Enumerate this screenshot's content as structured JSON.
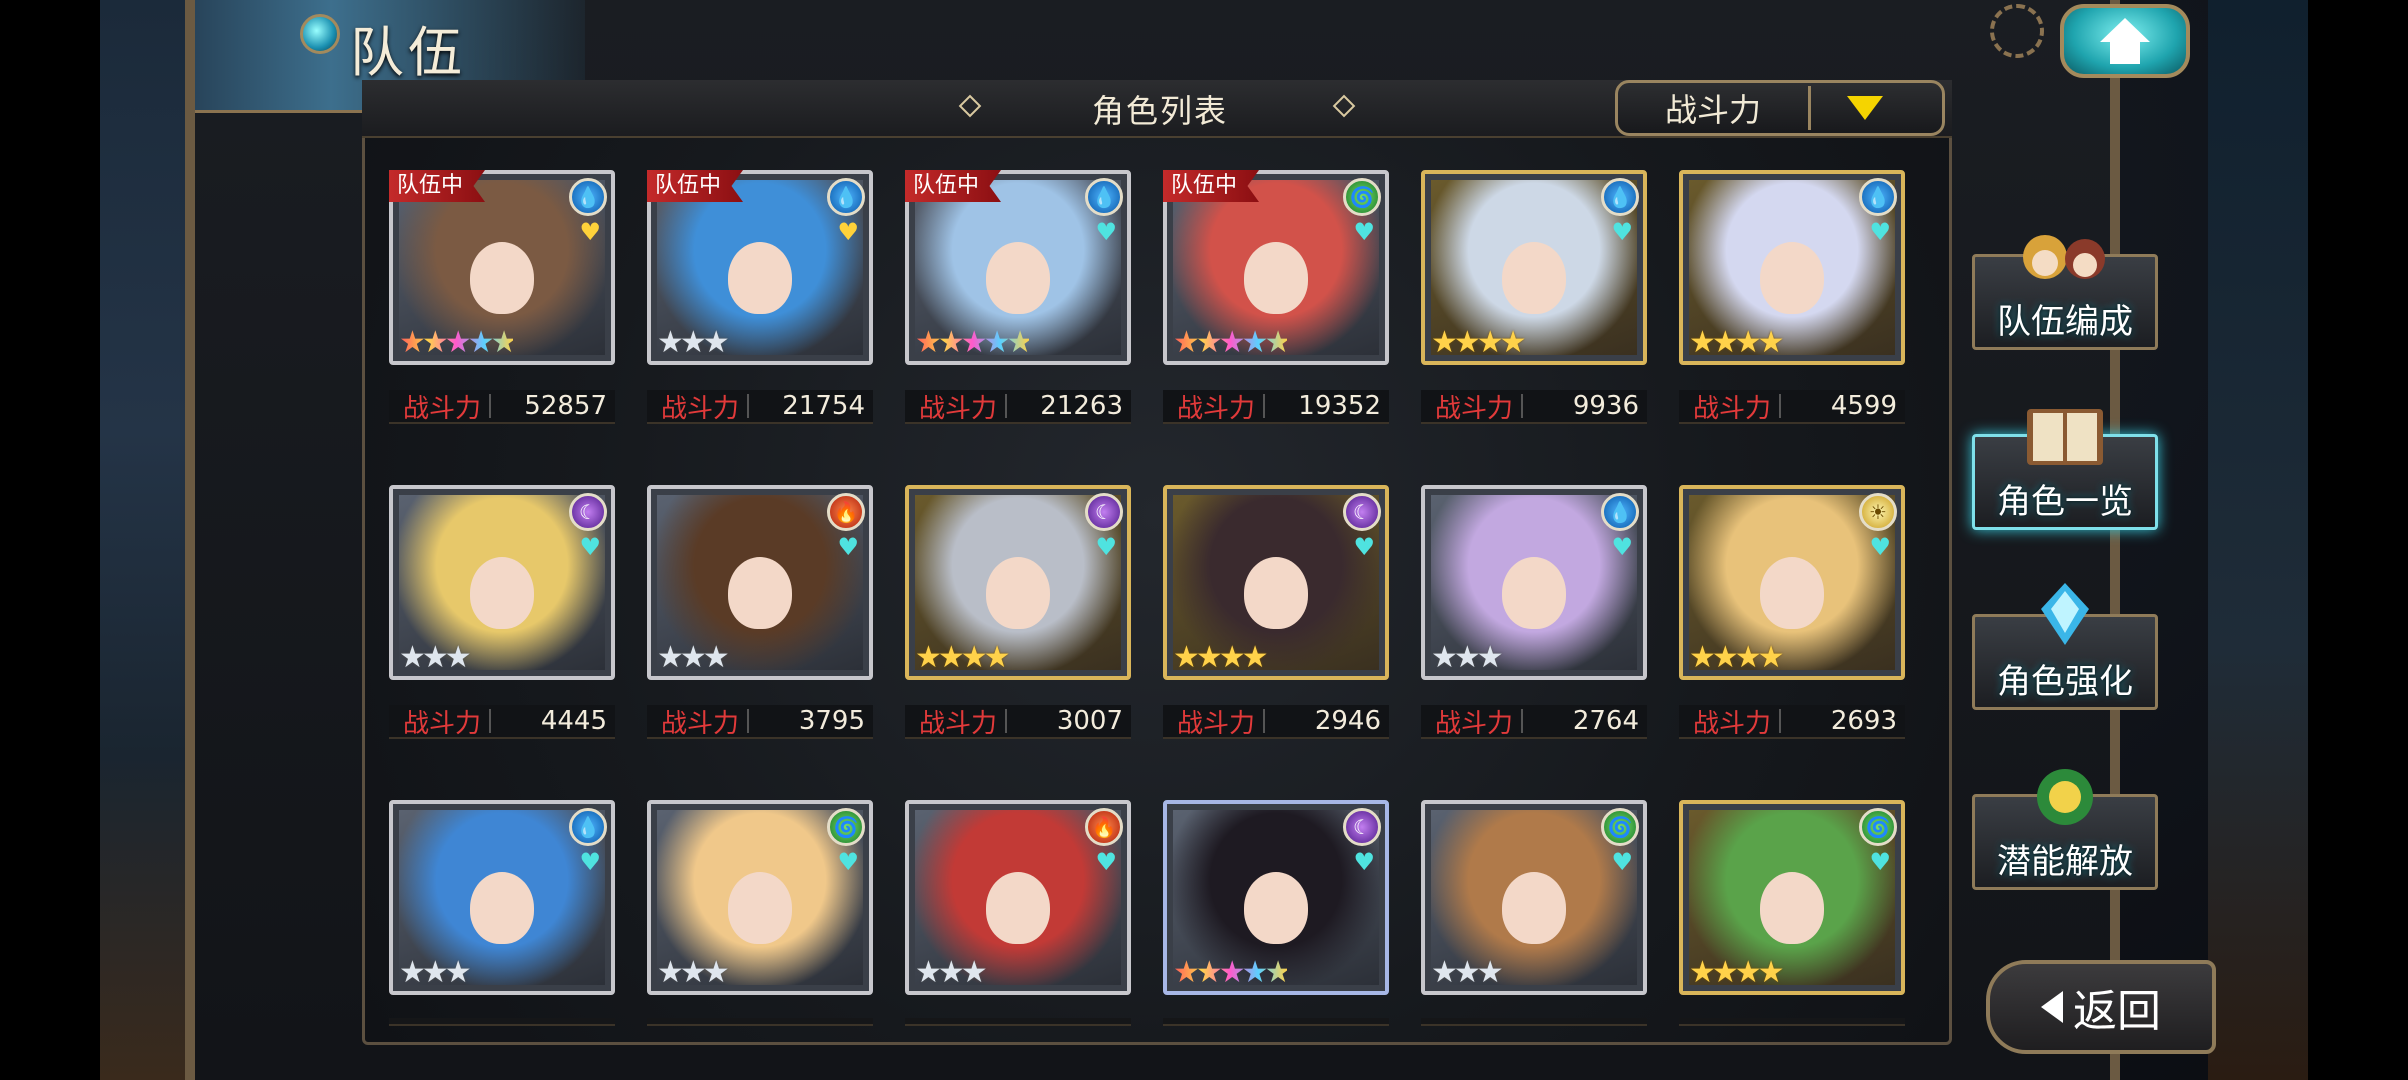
{
  "header": {
    "title": "队伍"
  },
  "panel": {
    "title": "角色列表",
    "sort": {
      "label": "战斗力"
    }
  },
  "power_label": "战斗力",
  "party_badge": "队伍中",
  "cards": [
    {
      "badge": true,
      "element": "water",
      "rarity": "rainbow",
      "frame": "silver",
      "heart": "yellow",
      "power": "52857",
      "hair": "#7b5a43"
    },
    {
      "badge": true,
      "element": "water",
      "rarity": "silver",
      "frame": "silver",
      "heart": "yellow",
      "power": "21754",
      "hair": "#3f8fd8"
    },
    {
      "badge": true,
      "element": "water",
      "rarity": "rainbow",
      "frame": "silver",
      "heart": "cyan",
      "power": "21263",
      "hair": "#9fc3e6"
    },
    {
      "badge": true,
      "element": "wind",
      "rarity": "rainbow",
      "frame": "silver",
      "heart": "cyan",
      "power": "19352",
      "hair": "#d2524a"
    },
    {
      "badge": false,
      "element": "water",
      "rarity": "gold",
      "frame": "gold",
      "heart": "cyan",
      "power": "9936",
      "hair": "#cdd8e6"
    },
    {
      "badge": false,
      "element": "water",
      "rarity": "gold",
      "frame": "gold",
      "heart": "cyan",
      "power": "4599",
      "hair": "#d4d8f0"
    },
    {
      "badge": false,
      "element": "dark",
      "rarity": "silver",
      "frame": "silver",
      "heart": "cyan",
      "power": "4445",
      "hair": "#e7c86a"
    },
    {
      "badge": false,
      "element": "fire",
      "rarity": "silver",
      "frame": "silver",
      "heart": "cyan",
      "power": "3795",
      "hair": "#5a3b26"
    },
    {
      "badge": false,
      "element": "dark",
      "rarity": "gold",
      "frame": "gold",
      "heart": "cyan",
      "power": "3007",
      "hair": "#b9bec8"
    },
    {
      "badge": false,
      "element": "dark",
      "rarity": "gold",
      "frame": "gold",
      "heart": "cyan",
      "power": "2946",
      "hair": "#3a2a2e"
    },
    {
      "badge": false,
      "element": "water",
      "rarity": "silver",
      "frame": "silver",
      "heart": "cyan",
      "power": "2764",
      "hair": "#c2a8e0"
    },
    {
      "badge": false,
      "element": "light",
      "rarity": "gold",
      "frame": "gold",
      "heart": "cyan",
      "power": "2693",
      "hair": "#e8c27a"
    },
    {
      "badge": false,
      "element": "water",
      "rarity": "silver",
      "frame": "silver",
      "heart": "cyan",
      "power": "",
      "hair": "#3f86d4"
    },
    {
      "badge": false,
      "element": "wind",
      "rarity": "silver",
      "frame": "silver",
      "heart": "cyan",
      "power": "",
      "hair": "#f0c88a"
    },
    {
      "badge": false,
      "element": "fire",
      "rarity": "silver",
      "frame": "silver",
      "heart": "cyan",
      "power": "",
      "hair": "#c23a36"
    },
    {
      "badge": false,
      "element": "dark",
      "rarity": "rainbow",
      "frame": "blue",
      "heart": "cyan",
      "power": "",
      "hair": "#1e1a22"
    },
    {
      "badge": false,
      "element": "wind",
      "rarity": "silver",
      "frame": "silver",
      "heart": "cyan",
      "power": "",
      "hair": "#b07a4a"
    },
    {
      "badge": false,
      "element": "wind",
      "rarity": "gold",
      "frame": "gold",
      "heart": "cyan",
      "power": "",
      "hair": "#5aa34a"
    }
  ],
  "side_menu": [
    {
      "label": "队伍编成",
      "name": "team-formation-button",
      "active": false,
      "icon": "characters-icon"
    },
    {
      "label": "角色一览",
      "name": "character-list-button",
      "active": true,
      "icon": "book-icon"
    },
    {
      "label": "角色强化",
      "name": "character-enhance-button",
      "active": false,
      "icon": "crystal-icon"
    },
    {
      "label": "潜能解放",
      "name": "potential-release-button",
      "active": false,
      "icon": "orb-icon"
    }
  ],
  "back_button": {
    "label": "返回"
  },
  "icons": {
    "home": "home-icon",
    "back": "back-arrow-icon",
    "sort": "dropdown-triangle-icon"
  }
}
